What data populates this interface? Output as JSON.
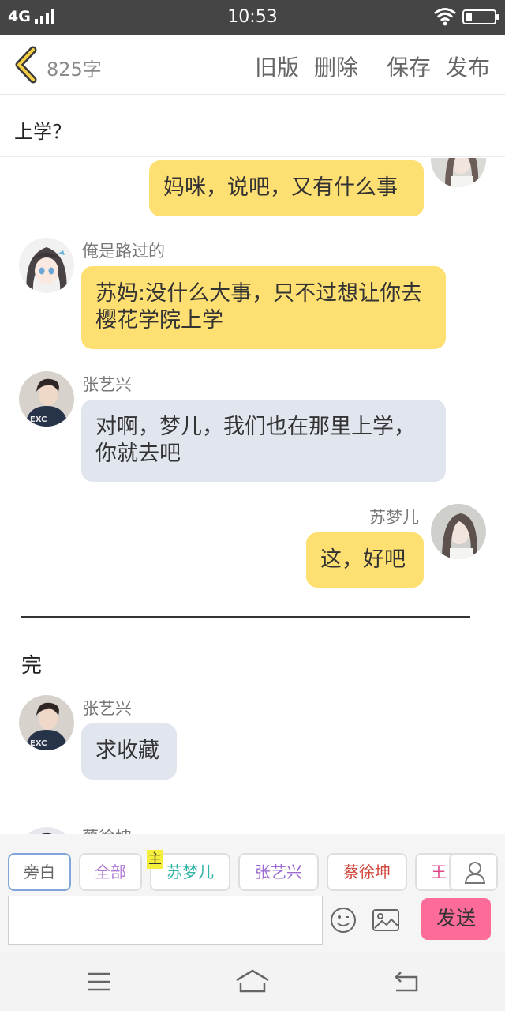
{
  "status_bar": {
    "network": "4G",
    "time": "10:53"
  },
  "toolbar": {
    "word_count": "825字",
    "old_version": "旧版",
    "delete": "删除",
    "save": "保存",
    "publish": "发布"
  },
  "story_title": "上学？",
  "messages": [
    {
      "side": "right",
      "color": "yellow",
      "name": "",
      "text": "妈咪，说吧，又有什么事"
    },
    {
      "side": "left",
      "color": "yellow",
      "name": "俺是路过的",
      "text": "苏妈:没什么大事，只不过想让你去樱花学院上学"
    },
    {
      "side": "left",
      "color": "grey",
      "name": "张艺兴",
      "text": "对啊，梦儿，我们也在那里上学，你就去吧"
    },
    {
      "side": "right",
      "color": "yellow",
      "name": "苏梦儿",
      "text": "这，好吧"
    },
    {
      "kind": "narration",
      "text": "完"
    },
    {
      "side": "left",
      "color": "grey",
      "name": "张艺兴",
      "text": "求收藏"
    },
    {
      "side": "left",
      "name": "蔡徐坤",
      "text": ""
    }
  ],
  "characters": {
    "narrator": "旁白",
    "all": "全部",
    "main_badge": "主",
    "su_menger": "苏梦儿",
    "zhang_yixing": "张艺兴",
    "cai_xukun": "蔡徐坤",
    "wang_partial": "王"
  },
  "input": {
    "value": "",
    "placeholder": ""
  },
  "send_label": "发送",
  "colors": {
    "yellow_bubble": "#fedf72",
    "grey_bubble": "#e0e5ee",
    "send_button": "#fd6b98",
    "status_bar": "#454545"
  },
  "icons": [
    "back-chevron-icon",
    "wifi-icon",
    "battery-icon",
    "person-icon",
    "emoji-icon",
    "image-icon",
    "menu-icon",
    "home-icon",
    "back-icon"
  ]
}
